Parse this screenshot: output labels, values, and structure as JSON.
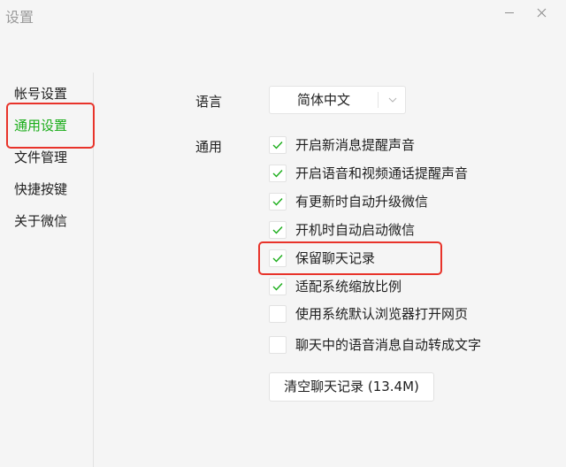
{
  "window": {
    "title": "设置"
  },
  "sidebar": {
    "items": [
      {
        "label": "帐号设置",
        "active": false
      },
      {
        "label": "通用设置",
        "active": true
      },
      {
        "label": "文件管理",
        "active": false
      },
      {
        "label": "快捷按键",
        "active": false
      },
      {
        "label": "关于微信",
        "active": false
      }
    ]
  },
  "language": {
    "label": "语言",
    "value": "简体中文"
  },
  "general": {
    "label": "通用",
    "options": [
      {
        "label": "开启新消息提醒声音",
        "checked": true
      },
      {
        "label": "开启语音和视频通话提醒声音",
        "checked": true
      },
      {
        "label": "有更新时自动升级微信",
        "checked": true
      },
      {
        "label": "开机时自动启动微信",
        "checked": true
      },
      {
        "label": "保留聊天记录",
        "checked": true
      },
      {
        "label": "适配系统缩放比例",
        "checked": true
      },
      {
        "label": "使用系统默认浏览器打开网页",
        "checked": false
      },
      {
        "label": "聊天中的语音消息自动转成文字",
        "checked": false
      }
    ]
  },
  "clear_button": {
    "label": "清空聊天记录 (13.4M)"
  },
  "colors": {
    "accent": "#1aad19",
    "annotation": "#e8332a",
    "background": "#f5f5f5"
  }
}
